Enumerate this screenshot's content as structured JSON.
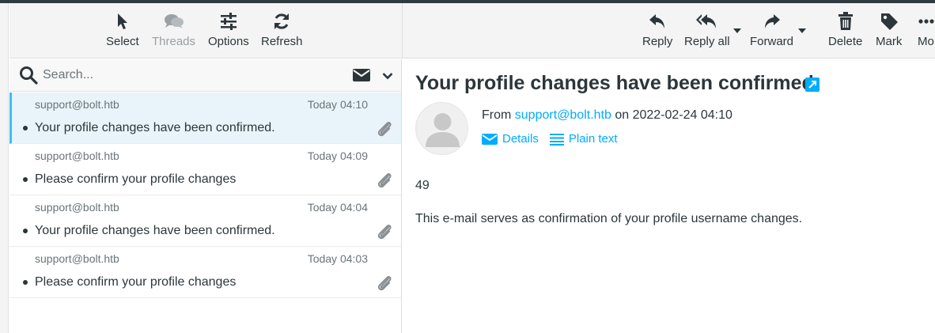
{
  "list_toolbar": {
    "select_label": "Select",
    "threads_label": "Threads",
    "options_label": "Options",
    "refresh_label": "Refresh"
  },
  "mail_toolbar": {
    "reply_label": "Reply",
    "reply_all_label": "Reply all",
    "forward_label": "Forward",
    "delete_label": "Delete",
    "mark_label": "Mark",
    "more_label": "Mo"
  },
  "search": {
    "placeholder": "Search..."
  },
  "messages": [
    {
      "from": "support@bolt.htb",
      "date": "Today 04:10",
      "subject": "Your profile changes have been confirmed.",
      "selected": true,
      "has_attachment": true
    },
    {
      "from": "support@bolt.htb",
      "date": "Today 04:09",
      "subject": "Please confirm your profile changes",
      "selected": false,
      "has_attachment": true
    },
    {
      "from": "support@bolt.htb",
      "date": "Today 04:04",
      "subject": "Your profile changes have been confirmed.",
      "selected": false,
      "has_attachment": true
    },
    {
      "from": "support@bolt.htb",
      "date": "Today 04:03",
      "subject": "Please confirm your profile changes",
      "selected": false,
      "has_attachment": true
    }
  ],
  "message_view": {
    "subject": "Your profile changes have been confirmed.",
    "from_prefix": "From",
    "from_address": "support@bolt.htb",
    "on_text": "on 2022-02-24 04:10",
    "details_label": "Details",
    "plain_text_label": "Plain text",
    "body_line1": "49",
    "body_line2": "This e-mail serves as confirmation of your profile username changes."
  },
  "colors": {
    "accent": "#00acff",
    "selected_row": "#e8f4f9",
    "selected_border": "#37beff",
    "text": "#2c363a"
  },
  "icons": [
    "pointer-icon",
    "threads-icon",
    "sliders-icon",
    "refresh-icon",
    "reply-icon",
    "reply-all-icon",
    "forward-icon",
    "trash-icon",
    "tag-icon",
    "more-icon",
    "search-icon",
    "envelope-icon",
    "chevron-down-icon",
    "paperclip-icon",
    "open-in-window-icon",
    "avatar-icon",
    "list-lines-icon"
  ]
}
